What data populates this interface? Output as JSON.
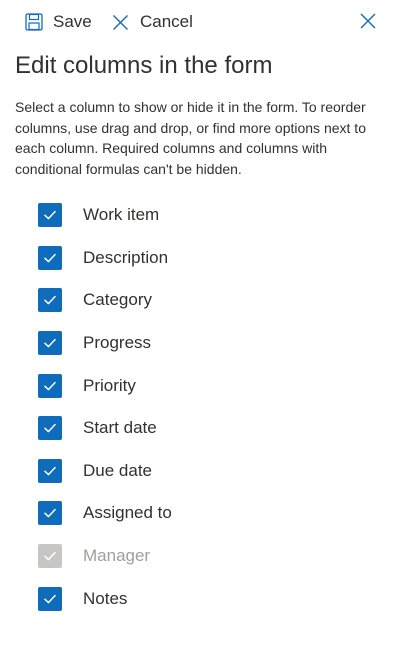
{
  "toolbar": {
    "save_label": "Save",
    "cancel_label": "Cancel"
  },
  "title": "Edit columns in the form",
  "description": "Select a column to show or hide it in the form. To reorder columns, use drag and drop, or find more options next to each column. Required columns and columns with conditional formulas can't be hidden.",
  "columns": [
    {
      "label": "Work item",
      "checked": true,
      "disabled": false
    },
    {
      "label": "Description",
      "checked": true,
      "disabled": false
    },
    {
      "label": "Category",
      "checked": true,
      "disabled": false
    },
    {
      "label": "Progress",
      "checked": true,
      "disabled": false
    },
    {
      "label": "Priority",
      "checked": true,
      "disabled": false
    },
    {
      "label": "Start date",
      "checked": true,
      "disabled": false
    },
    {
      "label": "Due date",
      "checked": true,
      "disabled": false
    },
    {
      "label": "Assigned to",
      "checked": true,
      "disabled": false
    },
    {
      "label": "Manager",
      "checked": true,
      "disabled": true
    },
    {
      "label": "Notes",
      "checked": true,
      "disabled": false
    }
  ],
  "colors": {
    "accent": "#0f6cbd",
    "disabled_check": "#c8c6c4",
    "text": "#323130",
    "disabled_text": "#a19f9d"
  },
  "icons": {
    "save": "save-icon",
    "cancel": "cancel-icon",
    "close": "close-icon",
    "check": "checkmark-icon"
  }
}
